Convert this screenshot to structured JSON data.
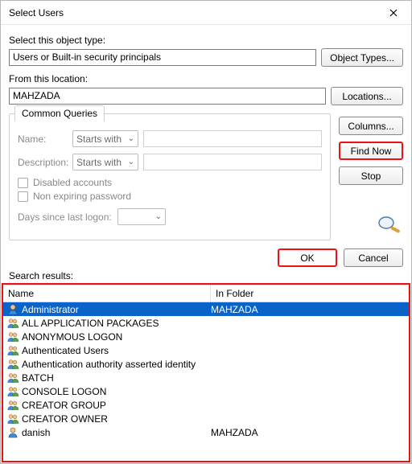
{
  "window": {
    "title": "Select Users"
  },
  "objectType": {
    "label": "Select this object type:",
    "value": "Users or Built-in security principals",
    "button": "Object Types..."
  },
  "location": {
    "label": "From this location:",
    "value": "MAHZADA",
    "button": "Locations..."
  },
  "queries": {
    "tab": "Common Queries",
    "nameLabel": "Name:",
    "nameMode": "Starts with",
    "descLabel": "Description:",
    "descMode": "Starts with",
    "disabledAccounts": "Disabled accounts",
    "nonExpiring": "Non expiring password",
    "daysSinceLabel": "Days since last logon:"
  },
  "sideButtons": {
    "columns": "Columns...",
    "findNow": "Find Now",
    "stop": "Stop"
  },
  "actions": {
    "ok": "OK",
    "cancel": "Cancel"
  },
  "search": {
    "label": "Search results:",
    "headers": {
      "name": "Name",
      "folder": "In Folder"
    },
    "rows": [
      {
        "icon": "user",
        "name": "Administrator",
        "folder": "MAHZADA",
        "selected": true
      },
      {
        "icon": "group",
        "name": "ALL APPLICATION PACKAGES",
        "folder": "",
        "selected": false
      },
      {
        "icon": "group",
        "name": "ANONYMOUS LOGON",
        "folder": "",
        "selected": false
      },
      {
        "icon": "group",
        "name": "Authenticated Users",
        "folder": "",
        "selected": false
      },
      {
        "icon": "group",
        "name": "Authentication authority asserted identity",
        "folder": "",
        "selected": false
      },
      {
        "icon": "group",
        "name": "BATCH",
        "folder": "",
        "selected": false
      },
      {
        "icon": "group",
        "name": "CONSOLE LOGON",
        "folder": "",
        "selected": false
      },
      {
        "icon": "group",
        "name": "CREATOR GROUP",
        "folder": "",
        "selected": false
      },
      {
        "icon": "group",
        "name": "CREATOR OWNER",
        "folder": "",
        "selected": false
      },
      {
        "icon": "user",
        "name": "danish",
        "folder": "MAHZADA",
        "selected": false
      }
    ]
  }
}
